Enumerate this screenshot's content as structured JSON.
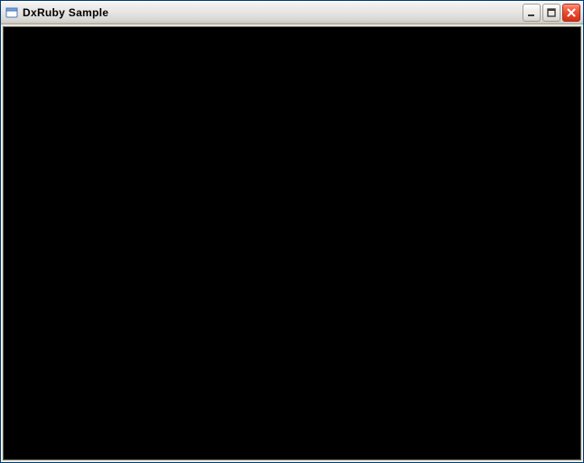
{
  "window": {
    "title": "DxRuby Sample",
    "icons": {
      "app": "window-icon",
      "minimize": "minimize-icon",
      "maximize": "maximize-icon",
      "close": "close-icon"
    },
    "colors": {
      "titlebar_inactive_top": "#f6f5f2",
      "titlebar_inactive_bottom": "#c8c5bf",
      "close_red": "#e7482f",
      "client_bg": "#000000"
    }
  }
}
